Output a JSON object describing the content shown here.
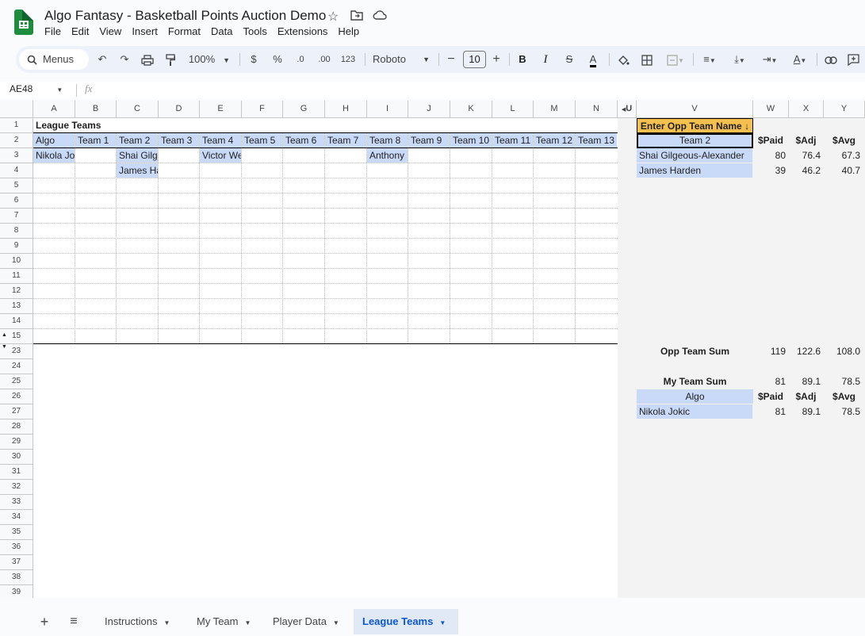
{
  "doc": {
    "title": "Algo Fantasy - Basketball Points Auction Demo"
  },
  "menu": [
    "File",
    "Edit",
    "View",
    "Insert",
    "Format",
    "Data",
    "Tools",
    "Extensions",
    "Help"
  ],
  "toolbar": {
    "search": "Menus",
    "zoom": "100%",
    "currency": "$",
    "percent": "%",
    "dec_less": ".0",
    "dec_more": ".00",
    "format_123": "123",
    "font": "Roboto",
    "font_size": "10"
  },
  "formula_bar": {
    "name_box": "AE48",
    "fx": "fx"
  },
  "columns_left": [
    "A",
    "B",
    "C",
    "D",
    "E",
    "F",
    "G",
    "H",
    "I",
    "J",
    "K",
    "L",
    "M",
    "N"
  ],
  "columns_right": [
    "V",
    "W",
    "X",
    "Y"
  ],
  "hidden_col_marker": "U",
  "rows": [
    "1",
    "2",
    "3",
    "4",
    "5",
    "6",
    "7",
    "8",
    "9",
    "10",
    "11",
    "12",
    "13",
    "14",
    "15",
    "23",
    "24",
    "25",
    "26",
    "27",
    "28",
    "29",
    "30",
    "31",
    "32",
    "33",
    "34",
    "35",
    "36",
    "37",
    "38",
    "39"
  ],
  "league": {
    "title": "League Teams",
    "headers": [
      "Algo",
      "Team 1",
      "Team 2",
      "Team 3",
      "Team 4",
      "Team 5",
      "Team 6",
      "Team 7",
      "Team 8",
      "Team 9",
      "Team 10",
      "Team 11",
      "Team 12",
      "Team 13"
    ],
    "row3": [
      "Nikola Jokic",
      "",
      "Shai Gilgeous-Alexander",
      "",
      "Victor Wembanyama",
      "",
      "",
      "",
      "Anthony Davis",
      "",
      "",
      "",
      "",
      ""
    ],
    "row4": [
      "",
      "",
      "James Harden",
      "",
      "",
      "",
      "",
      "",
      "",
      "",
      "",
      "",
      "",
      ""
    ]
  },
  "opp": {
    "prompt": "Enter Opp Team Name ↓",
    "team": "Team 2",
    "headers": [
      "$Paid",
      "$Adj",
      "$Avg"
    ],
    "players": [
      {
        "name": "Shai Gilgeous-Alexander",
        "paid": "80",
        "adj": "76.4",
        "avg": "67.3"
      },
      {
        "name": "James Harden",
        "paid": "39",
        "adj": "46.2",
        "avg": "40.7"
      }
    ],
    "sum_label": "Opp Team Sum",
    "sum": {
      "paid": "119",
      "adj": "122.6",
      "avg": "108.0"
    }
  },
  "mine": {
    "sum_label": "My Team Sum",
    "sum": {
      "paid": "81",
      "adj": "89.1",
      "avg": "78.5"
    },
    "team": "Algo",
    "headers": [
      "$Paid",
      "$Adj",
      "$Avg"
    ],
    "players": [
      {
        "name": "Nikola Jokic",
        "paid": "81",
        "adj": "89.1",
        "avg": "78.5"
      }
    ]
  },
  "tabs": [
    {
      "label": "Instructions"
    },
    {
      "label": "My Team"
    },
    {
      "label": "Player Data"
    },
    {
      "label": "League Teams"
    }
  ]
}
